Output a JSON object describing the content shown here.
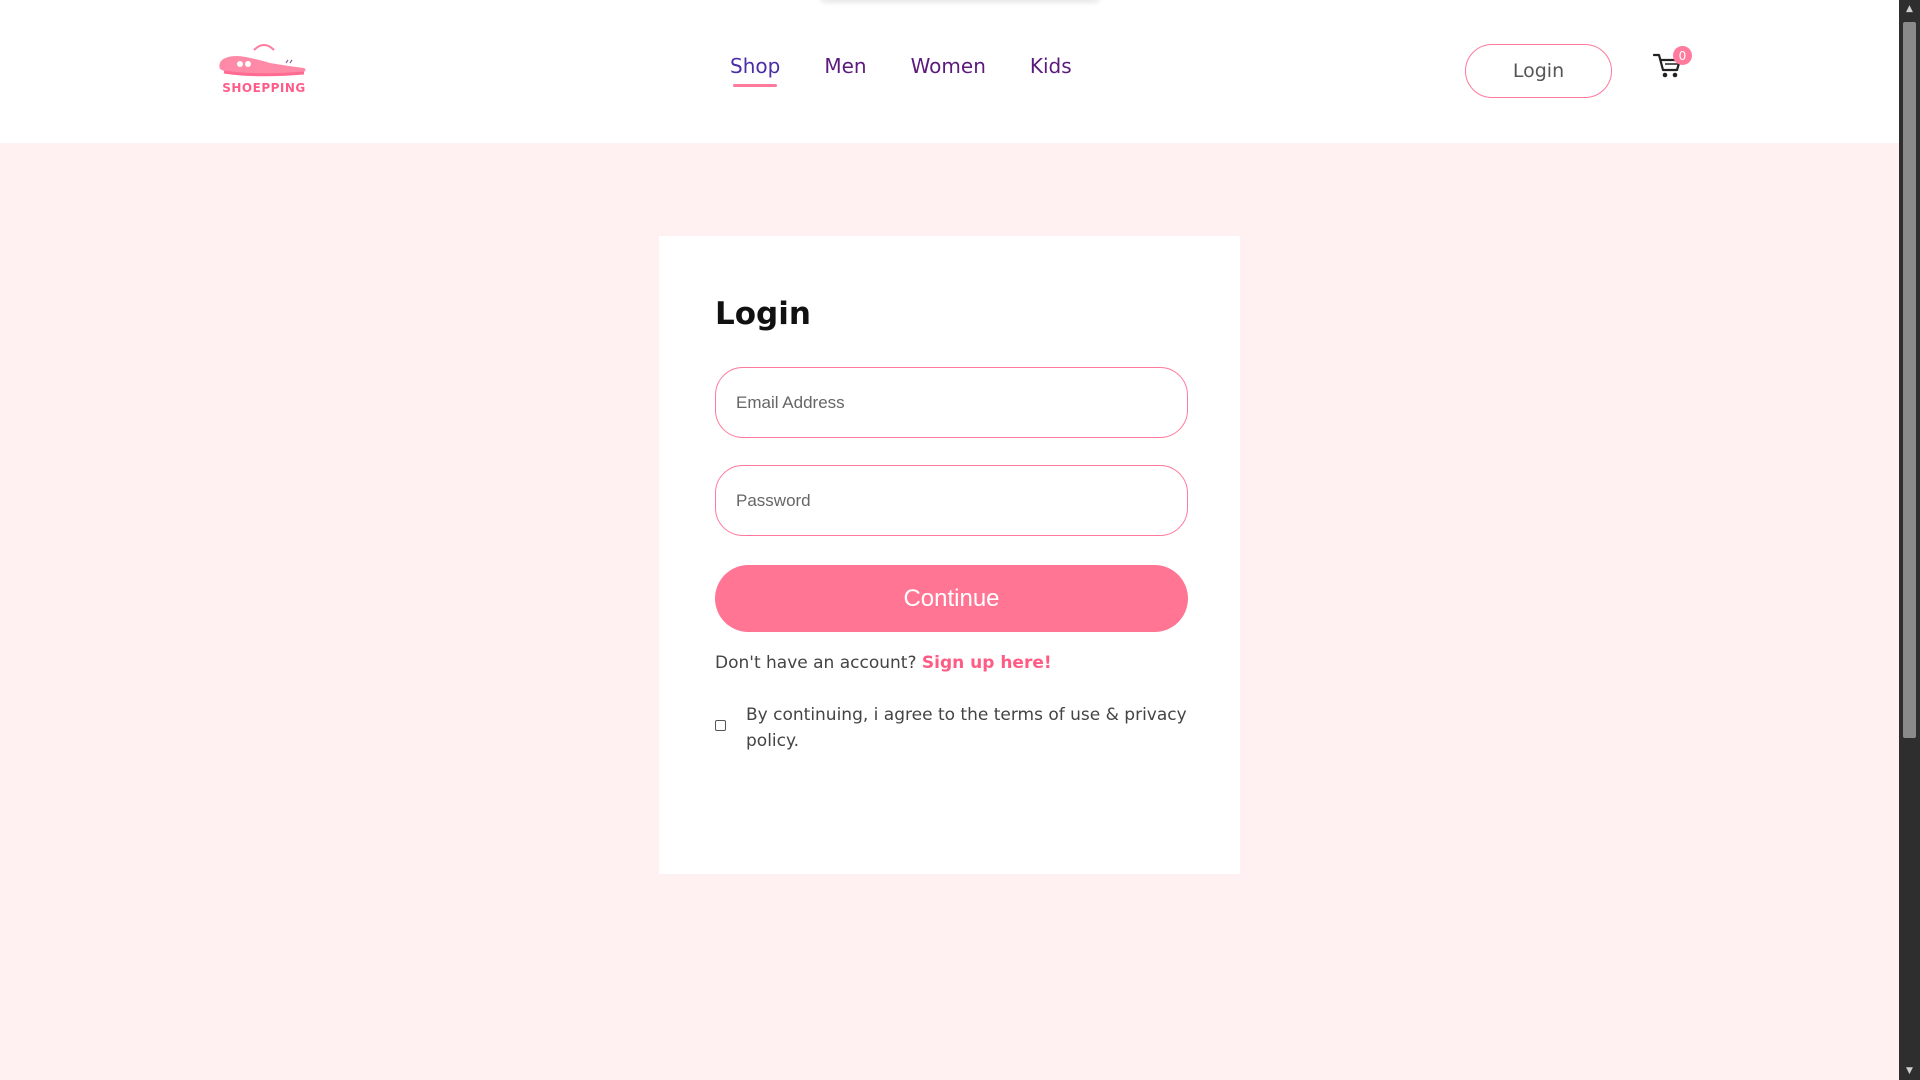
{
  "brand": {
    "name": "SHOEPPING",
    "logo_icon": "shoe-logo-icon",
    "color": "#ff5c8a"
  },
  "nav": {
    "links": [
      {
        "label": "Shop",
        "active": true
      },
      {
        "label": "Men",
        "active": false
      },
      {
        "label": "Women",
        "active": false
      },
      {
        "label": "Kids",
        "active": false
      }
    ],
    "login_label": "Login",
    "cart_icon": "cart-icon",
    "cart_count": "0"
  },
  "login_form": {
    "title": "Login",
    "email_placeholder": "Email Address",
    "password_placeholder": "Password",
    "continue_label": "Continue",
    "signup_prompt": "Don't have an account?",
    "signup_link": "Sign up here!",
    "agree_text": "By continuing, i agree to the terms of use & privacy policy."
  },
  "colors": {
    "accent": "#ff7593",
    "page_background": "#fff0f2",
    "nav_text": "#5b1a7c"
  }
}
